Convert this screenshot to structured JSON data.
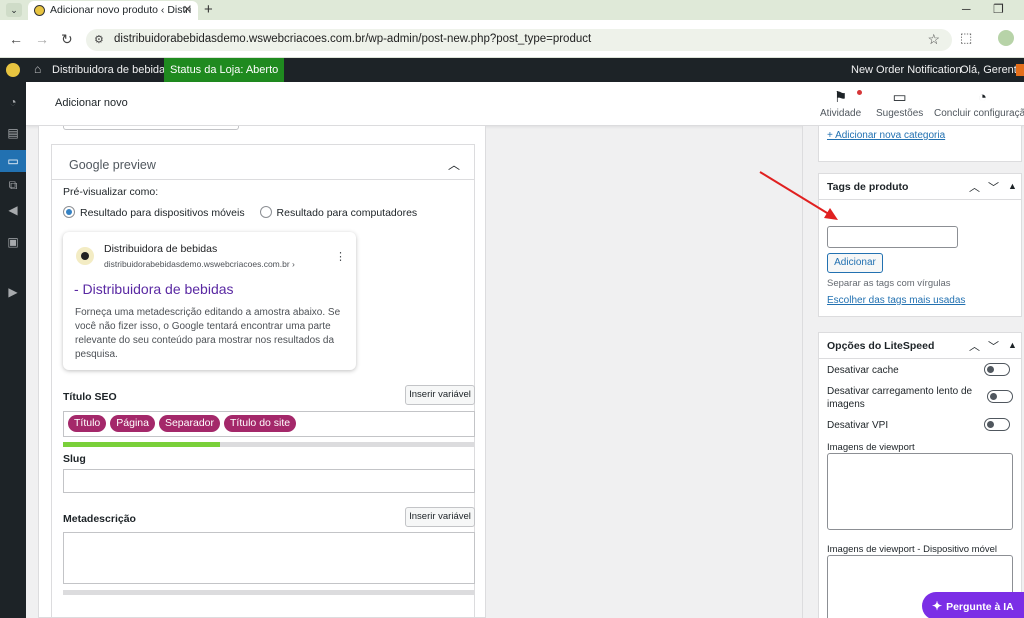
{
  "browser": {
    "tab_title": "Adicionar novo produto ‹ Distri",
    "tab_close": "✕",
    "new_tab": "+",
    "url": "distribuidorabebidasdemo.wswebcriacoes.com.br/wp-admin/post-new.php?post_type=product"
  },
  "adminbar": {
    "site_name": "Distribuidora de bebidas",
    "store_status": "Status da Loja: Aberto",
    "order_notification": "New Order Notification",
    "greeting": "Olá, Gerente"
  },
  "header": {
    "page_title": "Adicionar novo",
    "activity": "Atividade",
    "suggestions": "Sugestões",
    "finish_setup": "Concluir configuração"
  },
  "seo": {
    "panel_title": "Google preview",
    "preview_as": "Pré-visualizar como:",
    "radio_mobile": "Resultado para dispositivos móveis",
    "radio_desktop": "Resultado para computadores",
    "selected_preview": "mobile",
    "serp_site": "Distribuidora de bebidas",
    "serp_url": "distribuidorabebidasdemo.wswebcriacoes.com.br ›",
    "serp_title": "- Distribuidora de bebidas",
    "serp_description": "Forneça uma metadescrição editando a amostra abaixo. Se você não fizer isso, o Google tentará encontrar uma parte relevante do seu conteúdo para mostrar nos resultados da pesquisa.",
    "seo_title_label": "Título SEO",
    "insert_variable": "Inserir variável",
    "chips": [
      "Título",
      "Página",
      "Separador",
      "Título do site"
    ],
    "title_progress": 0.38,
    "slug_label": "Slug",
    "slug_value": "",
    "meta_label": "Metadescrição",
    "meta_value": "",
    "meta_progress": 0
  },
  "sidebar": {
    "add_category": "+ Adicionar nova categoria",
    "tags": {
      "title": "Tags de produto",
      "input_value": "",
      "add_button": "Adicionar",
      "hint": "Separar as tags com vírgulas",
      "most_used": "Escolher das tags mais usadas"
    },
    "litespeed": {
      "title": "Opções do LiteSpeed",
      "disable_cache": "Desativar cache",
      "disable_lazy": "Desativar carregamento lento de imagens",
      "disable_vpi": "Desativar VPI",
      "viewport_images": "Imagens de viewport",
      "viewport_images_mobile": "Imagens de viewport - Dispositivo móvel",
      "toggles": {
        "cache": false,
        "lazy": false,
        "vpi": false
      }
    }
  },
  "ai_button": "Pergunte à IA",
  "colors": {
    "wp_dark": "#1d2327",
    "status_green": "#1f8a1f",
    "chip": "#a4286a",
    "progress": "#7ad03a",
    "link": "#2271b1",
    "ai_purple": "#7b2ee6",
    "annotation_arrow": "#e02020"
  }
}
